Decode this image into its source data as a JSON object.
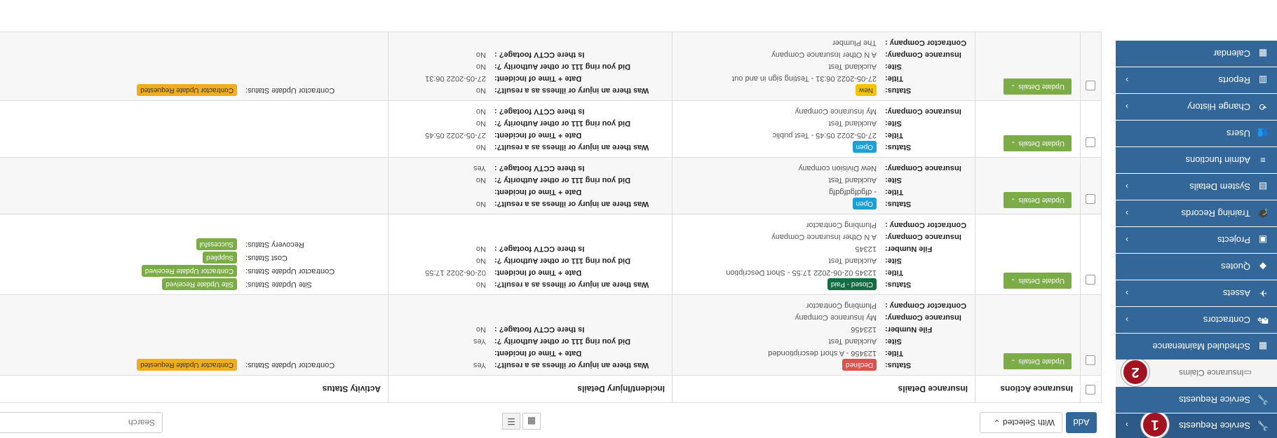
{
  "sidebar": {
    "items": [
      {
        "label": "Service Requests",
        "icon": "wrench-icon",
        "chevron": true,
        "marker": "1"
      },
      {
        "label": "Service Requests",
        "icon": "wrench-icon",
        "chevron": false
      },
      {
        "label": "Insurance Claims",
        "icon": "document-icon",
        "sub": true,
        "marker": "2"
      },
      {
        "label": "Scheduled Maintenance",
        "icon": "calendar-grid-icon",
        "chevron": false
      },
      {
        "label": "Contractors",
        "icon": "truck-icon",
        "chevron": true
      },
      {
        "label": "Assets",
        "icon": "plane-icon",
        "chevron": true
      },
      {
        "label": "Quotes",
        "icon": "tag-icon",
        "chevron": false
      },
      {
        "label": "Projects",
        "icon": "image-icon",
        "chevron": true
      },
      {
        "label": "Training Records",
        "icon": "graduation-cap-icon",
        "chevron": true
      },
      {
        "label": "System Details",
        "icon": "card-icon",
        "chevron": true
      },
      {
        "label": "Admin functions",
        "icon": "bars-icon",
        "chevron": false
      },
      {
        "label": "Users",
        "icon": "users-icon",
        "chevron": false
      },
      {
        "label": "Change History",
        "icon": "history-icon",
        "chevron": true
      },
      {
        "label": "Reports",
        "icon": "bar-chart-icon",
        "chevron": true
      },
      {
        "label": "Calendar",
        "icon": "calendar-icon",
        "chevron": false
      }
    ]
  },
  "toolbar": {
    "add_label": "Add",
    "with_selected_label": "With Selected",
    "search_placeholder": "Search"
  },
  "table": {
    "headers": {
      "actions": "Insurance Actions",
      "details": "Insurance Details",
      "incident": "Incident/Injury Details",
      "activity": "Activity Status"
    },
    "update_label": "Update Details",
    "rows": [
      {
        "status": {
          "text": "Declined",
          "kind": "declined"
        },
        "details": [
          [
            "Title:",
            "123456 - A short descriptionded"
          ],
          [
            "Site:",
            "Auckland Test"
          ],
          [
            "File Number:",
            "123456"
          ],
          [
            "Insurance Company:",
            "My Insurance Company"
          ],
          [
            "Contractor Company :",
            "Plumbing Contractor"
          ]
        ],
        "incident": [
          [
            "Was there an injury or illness as a result?:",
            "Yes"
          ],
          [
            "Date + Time of Incident:",
            ""
          ],
          [
            "Did you ring 111 or other Authority ?:",
            "Yes"
          ],
          [
            "Is there CCTV footage? :",
            "No"
          ]
        ],
        "activity": [
          {
            "k": "Contractor Update Status:",
            "v": "Contractor Update Requested",
            "kind": "yellow"
          }
        ]
      },
      {
        "status": {
          "text": "Closed - Paid",
          "kind": "closed"
        },
        "details": [
          [
            "Title:",
            "12345 02-06-2022 17:55 - Short Description"
          ],
          [
            "Site:",
            "Auckland Test"
          ],
          [
            "File Number:",
            "12345"
          ],
          [
            "Insurance Company:",
            "A N Other Insurance Company"
          ],
          [
            "Contractor Company :",
            "Plumbing Contractor"
          ]
        ],
        "incident": [
          [
            "Was there an injury or illness as a result?:",
            "No"
          ],
          [
            "Date + Time of Incident:",
            "02-06-2022 17:55"
          ],
          [
            "Did you ring 111 or other Authority ?:",
            "No"
          ],
          [
            "Is there CCTV footage? :",
            "No"
          ]
        ],
        "activity": [
          {
            "k": "Site Update Status:",
            "v": "Site Update Received",
            "kind": "green"
          },
          {
            "k": "Contractor Update Status:",
            "v": "Contractor Update Received",
            "kind": "green"
          },
          {
            "k": "Cost Status:",
            "v": "Supplied",
            "kind": "green"
          },
          {
            "k": "Recovery Status:",
            "v": "Successful",
            "kind": "green"
          }
        ]
      },
      {
        "status": {
          "text": "Open",
          "kind": "open"
        },
        "details": [
          [
            "Title:",
            "- dfgdfgdfgdfg"
          ],
          [
            "Site:",
            "Auckland Test"
          ],
          [
            "Insurance Company:",
            "New Division company"
          ]
        ],
        "incident": [
          [
            "Was there an injury or illness as a result?:",
            "No"
          ],
          [
            "Date + Time of Incident:",
            ""
          ],
          [
            "Did you ring 111 or other Authority ?:",
            "No"
          ],
          [
            "Is there CCTV footage? :",
            "Yes"
          ]
        ],
        "activity": []
      },
      {
        "status": {
          "text": "Open",
          "kind": "open"
        },
        "details": [
          [
            "Title:",
            "27-05-2022 05:45 - Test public"
          ],
          [
            "Site:",
            "Auckland Test"
          ],
          [
            "Insurance Company:",
            "My Insurance Company"
          ]
        ],
        "incident": [
          [
            "Was there an injury or illness as a result?:",
            "No"
          ],
          [
            "Date + Time of Incident:",
            "27-05-2022 05:45"
          ],
          [
            "Did you ring 111 or other Authority ?:",
            "No"
          ],
          [
            "Is there CCTV footage? :",
            "No"
          ]
        ],
        "activity": []
      },
      {
        "status": {
          "text": "New",
          "kind": "new"
        },
        "details": [
          [
            "Title:",
            "27-05-2022 06:31 - Testing sign in and out"
          ],
          [
            "Site:",
            "Auckland Test"
          ],
          [
            "Insurance Company:",
            "A N Other Insurance Company"
          ],
          [
            "Contractor Company :",
            "The Plumber"
          ]
        ],
        "incident": [
          [
            "Was there an injury or illness as a result?:",
            "No"
          ],
          [
            "Date + Time of Incident:",
            "27-05-2022 06:31"
          ],
          [
            "Did you ring 111 or other Authority ?:",
            "No"
          ],
          [
            "Is there CCTV footage? :",
            "No"
          ]
        ],
        "activity": [
          {
            "k": "Contractor Update Status:",
            "v": "Contractor Update Requested",
            "kind": "yellow"
          }
        ]
      }
    ]
  },
  "colors": {
    "primary": "#336699",
    "update_green": "#7cac47",
    "declined": "#d9534f",
    "closed": "#146c43",
    "open": "#1a9fd8",
    "new": "#f5c400",
    "marker": "#a31221"
  }
}
